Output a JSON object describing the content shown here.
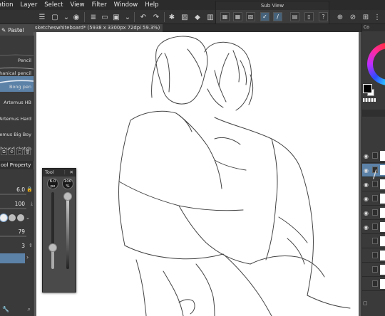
{
  "menu": {
    "items": [
      "ation",
      "Layer",
      "Select",
      "View",
      "Filter",
      "Window",
      "Help"
    ]
  },
  "subview": {
    "title": "Sub View"
  },
  "document": {
    "tab_title": "sketcheswhiteboard* (5938 x 3300px 72dpi 59.3%)"
  },
  "brush_panel": {
    "group_tab": "Pastel",
    "items": [
      {
        "label": "Pencil"
      },
      {
        "label": "chanical pencil"
      },
      {
        "label": "Bong pen"
      },
      {
        "label": "Artemus HB"
      },
      {
        "label": "Artemus Hard"
      },
      {
        "label": "Artemus Big Boy"
      },
      {
        "label": "shound sketch"
      }
    ],
    "selected_index": 2
  },
  "tool_property": {
    "title": "ool Property",
    "brush_size": "6.0",
    "opacity": "100",
    "hardness": "79",
    "stabilization": "3"
  },
  "tool_float": {
    "title": "Tool",
    "size_value": "6.0",
    "size_unit": "px",
    "opacity_value": "100",
    "opacity_unit": "%",
    "size_slider_fraction": 0.25,
    "opacity_slider_fraction": 1.0
  },
  "right_panel": {
    "color_header": "Co",
    "main_color": "#000000",
    "sub_color": "#ffffff",
    "accent": "#5c82a8"
  },
  "icons": {
    "toolbar": [
      "menu-icon",
      "new-file-icon",
      "dropdown-icon",
      "save-icon",
      "undo-icon",
      "redo-icon",
      "clear-icon",
      "fill-icon",
      "transform-icon",
      "selection-icon",
      "snap-icon",
      "grid-icon"
    ],
    "subview": [
      "subview-grid-icon",
      "subview-ruler-icon",
      "subview-select-icon",
      "subview-eyedropper-icon",
      "subview-import-icon",
      "subview-phone-icon",
      "subview-help-icon",
      "subview-settings-icon"
    ]
  }
}
